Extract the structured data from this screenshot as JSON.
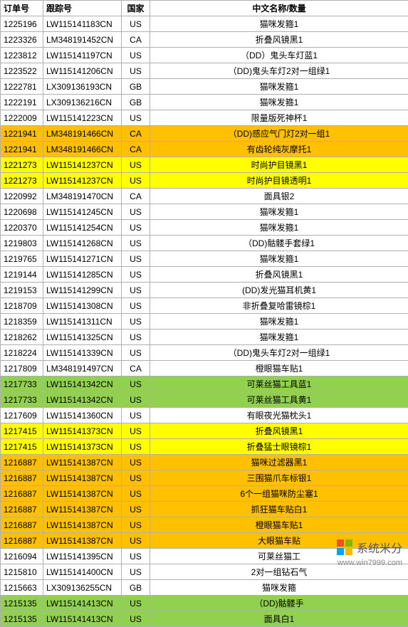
{
  "headers": {
    "order": "订单号",
    "track": "跟踪号",
    "country": "国家",
    "name": "中文名称/数量"
  },
  "rows": [
    {
      "hl": "normal",
      "order": "1225196",
      "track": "LW115141183CN",
      "country": "US",
      "name": "猫咪发箍1"
    },
    {
      "hl": "normal",
      "order": "1223326",
      "track": "LM348191452CN",
      "country": "CA",
      "name": "折叠风镜黑1"
    },
    {
      "hl": "normal",
      "order": "1223812",
      "track": "LW115141197CN",
      "country": "US",
      "name": "（DD）鬼头车灯蓝1"
    },
    {
      "hl": "normal",
      "order": "1223522",
      "track": "LW115141206CN",
      "country": "US",
      "name": "（DD)鬼头车灯2对一组绿1"
    },
    {
      "hl": "normal",
      "order": "1222781",
      "track": "LX309136193CN",
      "country": "GB",
      "name": "猫咪发箍1"
    },
    {
      "hl": "normal",
      "order": "1222191",
      "track": "LX309136216CN",
      "country": "GB",
      "name": "猫咪发箍1"
    },
    {
      "hl": "normal",
      "order": "1222009",
      "track": "LW115141223CN",
      "country": "US",
      "name": "限量版死神杯1"
    },
    {
      "hl": "orange",
      "order": "1221941",
      "track": "LM348191466CN",
      "country": "CA",
      "name": "（DD)感应气门灯2对一组1"
    },
    {
      "hl": "orange",
      "order": "1221941",
      "track": "LM348191466CN",
      "country": "CA",
      "name": "有齿轮纯灰摩托1"
    },
    {
      "hl": "yellow",
      "order": "1221273",
      "track": "LW115141237CN",
      "country": "US",
      "name": "时尚护目镜黑1"
    },
    {
      "hl": "yellow",
      "order": "1221273",
      "track": "LW115141237CN",
      "country": "US",
      "name": "时尚护目镜透明1"
    },
    {
      "hl": "normal",
      "order": "1220992",
      "track": "LM348191470CN",
      "country": "CA",
      "name": "面具银2"
    },
    {
      "hl": "normal",
      "order": "1220698",
      "track": "LW115141245CN",
      "country": "US",
      "name": "猫咪发箍1"
    },
    {
      "hl": "normal",
      "order": "1220370",
      "track": "LW115141254CN",
      "country": "US",
      "name": "猫咪发箍1"
    },
    {
      "hl": "normal",
      "order": "1219803",
      "track": "LW115141268CN",
      "country": "US",
      "name": "（DD)骷髅手套绿1"
    },
    {
      "hl": "normal",
      "order": "1219765",
      "track": "LW115141271CN",
      "country": "US",
      "name": "猫咪发箍1"
    },
    {
      "hl": "normal",
      "order": "1219144",
      "track": "LW115141285CN",
      "country": "US",
      "name": "折叠风镜黑1"
    },
    {
      "hl": "normal",
      "order": "1219153",
      "track": "LW115141299CN",
      "country": "US",
      "name": "(DD)发光猫耳机黄1"
    },
    {
      "hl": "normal",
      "order": "1218709",
      "track": "LW115141308CN",
      "country": "US",
      "name": "非折叠复哈雷镜棕1"
    },
    {
      "hl": "normal",
      "order": "1218359",
      "track": "LW115141311CN",
      "country": "US",
      "name": "猫咪发箍1"
    },
    {
      "hl": "normal",
      "order": "1218262",
      "track": "LW115141325CN",
      "country": "US",
      "name": "猫咪发箍1"
    },
    {
      "hl": "normal",
      "order": "1218224",
      "track": "LW115141339CN",
      "country": "US",
      "name": "（DD)鬼头车灯2对一组绿1"
    },
    {
      "hl": "normal",
      "order": "1217809",
      "track": "LM348191497CN",
      "country": "CA",
      "name": "橙眼猫车贴1"
    },
    {
      "hl": "green",
      "order": "1217733",
      "track": "LW115141342CN",
      "country": "US",
      "name": "可莱丝猫工具蓝1"
    },
    {
      "hl": "green",
      "order": "1217733",
      "track": "LW115141342CN",
      "country": "US",
      "name": "可莱丝猫工具黄1"
    },
    {
      "hl": "normal",
      "order": "1217609",
      "track": "LW115141360CN",
      "country": "US",
      "name": "有眼夜光猫枕头1"
    },
    {
      "hl": "yellow",
      "order": "1217415",
      "track": "LW115141373CN",
      "country": "US",
      "name": "折叠风镜黑1"
    },
    {
      "hl": "yellow",
      "order": "1217415",
      "track": "LW115141373CN",
      "country": "US",
      "name": "折叠猛士眼镜棕1"
    },
    {
      "hl": "orange",
      "order": "1216887",
      "track": "LW115141387CN",
      "country": "US",
      "name": "猫咪过滤器黑1"
    },
    {
      "hl": "orange",
      "order": "1216887",
      "track": "LW115141387CN",
      "country": "US",
      "name": "三围猫爪车标银1"
    },
    {
      "hl": "orange",
      "order": "1216887",
      "track": "LW115141387CN",
      "country": "US",
      "name": "6个一组猫咪防尘塞1"
    },
    {
      "hl": "orange",
      "order": "1216887",
      "track": "LW115141387CN",
      "country": "US",
      "name": "抓狂猫车贴白1"
    },
    {
      "hl": "orange",
      "order": "1216887",
      "track": "LW115141387CN",
      "country": "US",
      "name": "橙眼猫车贴1"
    },
    {
      "hl": "orange",
      "order": "1216887",
      "track": "LW115141387CN",
      "country": "US",
      "name": "大眼猫车贴"
    },
    {
      "hl": "normal",
      "order": "1216094",
      "track": "LW115141395CN",
      "country": "US",
      "name": "可莱丝猫工"
    },
    {
      "hl": "normal",
      "order": "1215810",
      "track": "LW115141400CN",
      "country": "US",
      "name": "2对一组钻石气"
    },
    {
      "hl": "normal",
      "order": "1215663",
      "track": "LX309136255CN",
      "country": "GB",
      "name": "猫咪发箍"
    },
    {
      "hl": "green",
      "order": "1215135",
      "track": "LW115141413CN",
      "country": "US",
      "name": "（DD)骷髅手"
    },
    {
      "hl": "green",
      "order": "1215135",
      "track": "LW115141413CN",
      "country": "US",
      "name": "面具白1"
    }
  ],
  "watermark": {
    "brand": "系统米分",
    "url": "www.win7999.com"
  }
}
